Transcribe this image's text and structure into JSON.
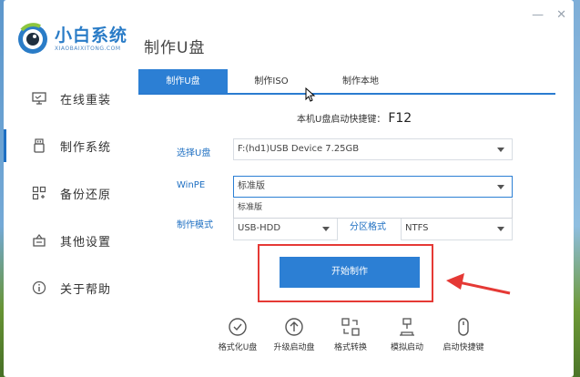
{
  "app": {
    "name": "小白系统",
    "subtitle": "XIAOBAIXITONG.COM"
  },
  "page_title": "制作U盘",
  "sidebar": {
    "items": [
      {
        "label": "在线重装",
        "icon": "monitor-icon"
      },
      {
        "label": "制作系统",
        "icon": "usb-icon",
        "active": true
      },
      {
        "label": "备份还原",
        "icon": "backup-grid-icon"
      },
      {
        "label": "其他设置",
        "icon": "settings-box-icon"
      },
      {
        "label": "关于帮助",
        "icon": "info-icon"
      }
    ]
  },
  "tabs": [
    {
      "label": "制作U盘",
      "active": true
    },
    {
      "label": "制作ISO"
    },
    {
      "label": "制作本地"
    }
  ],
  "hotkey": {
    "label": "本机U盘启动快捷键：",
    "key": "F12"
  },
  "form": {
    "usb_label": "选择U盘",
    "usb_value": "F:(hd1)USB Device 7.25GB",
    "winpe_label": "WinPE",
    "winpe_value": "标准版",
    "winpe_dropdown_option": "标准版",
    "mode_label": "制作模式",
    "mode_value": "USB-HDD",
    "partition_label": "分区格式",
    "partition_value": "NTFS"
  },
  "start_button": "开始制作",
  "tools": [
    {
      "label": "格式化U盘",
      "icon": "check-circle-icon"
    },
    {
      "label": "升级启动盘",
      "icon": "upload-circle-icon"
    },
    {
      "label": "格式转换",
      "icon": "convert-icon"
    },
    {
      "label": "模拟启动",
      "icon": "simulate-icon"
    },
    {
      "label": "启动快捷键",
      "icon": "mouse-icon"
    }
  ],
  "colors": {
    "accent": "#2c7fd4",
    "highlight_frame": "#e53935"
  }
}
